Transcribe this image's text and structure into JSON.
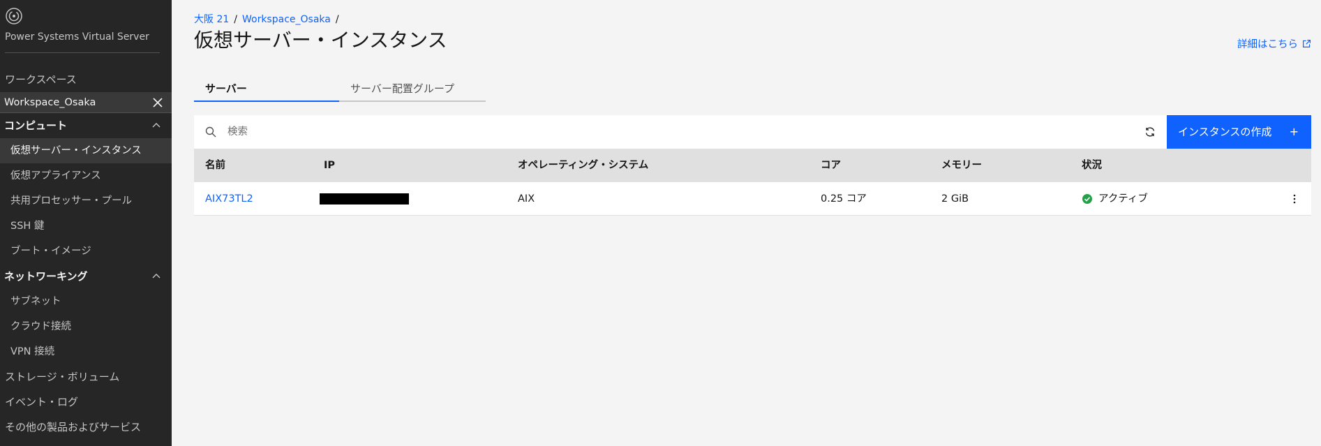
{
  "sidebar": {
    "product_name": "Power Systems Virtual Server",
    "workspaces_label": "ワークスペース",
    "current_workspace": "Workspace_Osaka",
    "compute_label": "コンピュート",
    "compute_items": [
      "仮想サーバー・インスタンス",
      "仮想アプライアンス",
      "共用プロセッサー・プール",
      "SSH 鍵",
      "ブート・イメージ"
    ],
    "networking_label": "ネットワーキング",
    "networking_items": [
      "サブネット",
      "クラウド接続",
      "VPN 接続"
    ],
    "storage_label": "ストレージ・ボリューム",
    "events_label": "イベント・ログ",
    "other_label": "その他の製品およびサービス"
  },
  "breadcrumb": {
    "region": "大阪 21",
    "workspace": "Workspace_Osaka",
    "sep": "/"
  },
  "page": {
    "title": "仮想サーバー・インスタンス",
    "learn_more": "詳細はこちら"
  },
  "tabs": {
    "servers": "サーバー",
    "placement_groups": "サーバー配置グループ"
  },
  "toolbar": {
    "search_placeholder": "検索",
    "create_button": "インスタンスの作成",
    "create_plus": "+"
  },
  "table": {
    "columns": {
      "name": "名前",
      "ip": "IP",
      "os": "オペレーティング・システム",
      "cores": "コア",
      "memory": "メモリー",
      "status": "状況"
    },
    "rows": [
      {
        "name": "AIX73TL2",
        "ip": "",
        "os": "AIX",
        "cores": "0.25 コア",
        "memory": "2 GiB",
        "status": "アクティブ"
      }
    ]
  },
  "colors": {
    "accent": "#0f62fe",
    "sidebar_bg": "#262626",
    "status_ok": "#24a148"
  }
}
